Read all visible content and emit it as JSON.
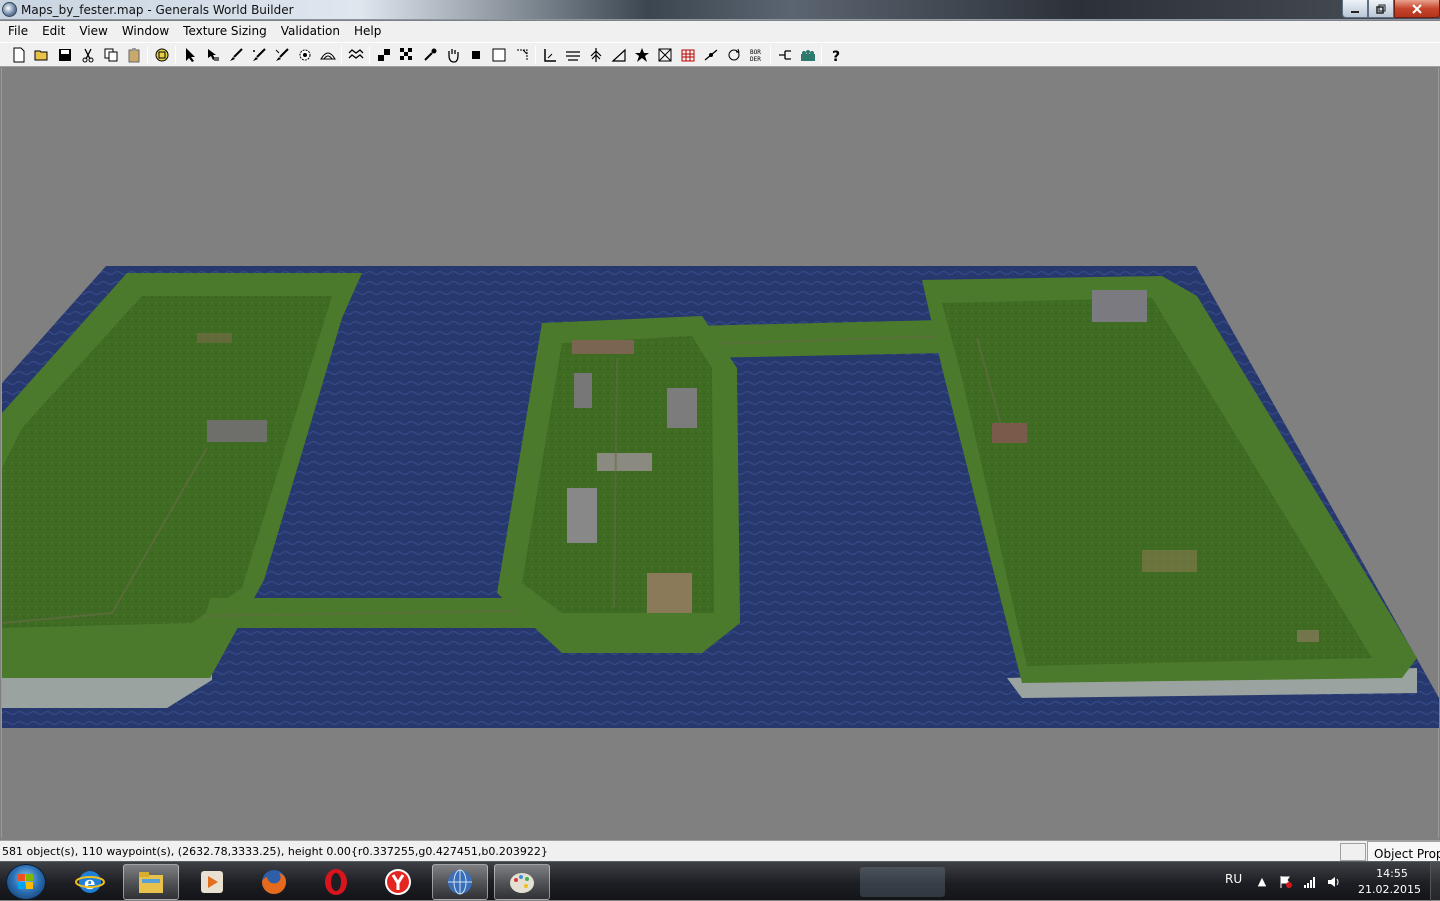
{
  "window": {
    "title": "Maps_by_fester.map - Generals World Builder"
  },
  "menu": [
    "File",
    "Edit",
    "View",
    "Window",
    "Texture Sizing",
    "Validation",
    "Help"
  ],
  "toolbar": {
    "buttons": [
      "new-file",
      "open-file",
      "save-file",
      "cut",
      "copy",
      "paste",
      "sep",
      "layers",
      "sep",
      "select-pointer",
      "grab-move",
      "brush",
      "feather",
      "brush-alt",
      "smooth",
      "crater",
      "sep",
      "water-waves",
      "sep",
      "tile",
      "checker",
      "eyedropper",
      "pan-hand",
      "solid-square",
      "hollow-square",
      "ramp",
      "sep",
      "road",
      "horizon",
      "tree",
      "triangle",
      "splat",
      "grid",
      "building",
      "waypoint",
      "rotate",
      "border",
      "sep",
      "light",
      "team",
      "sep",
      "help"
    ],
    "border_label": "BOR\nDER"
  },
  "status": {
    "text": "581 object(s), 110 waypoint(s), (2632.78,3333.25), height 0.00{r0.337255,g0.427451,b0.203922}",
    "panel_tab": "Object Prope"
  },
  "taskbar": {
    "apps": [
      "explorer",
      "windows-media",
      "firefox",
      "opera",
      "yandex",
      "world-builder",
      "paint"
    ],
    "active_app": "world-builder",
    "language": "RU",
    "time": "14:55",
    "date": "21.02.2015"
  },
  "colors": {
    "water": "#27386e",
    "grass": "#3f6b22",
    "cliff": "#9aa3a0",
    "viewport_bg": "#808080"
  }
}
